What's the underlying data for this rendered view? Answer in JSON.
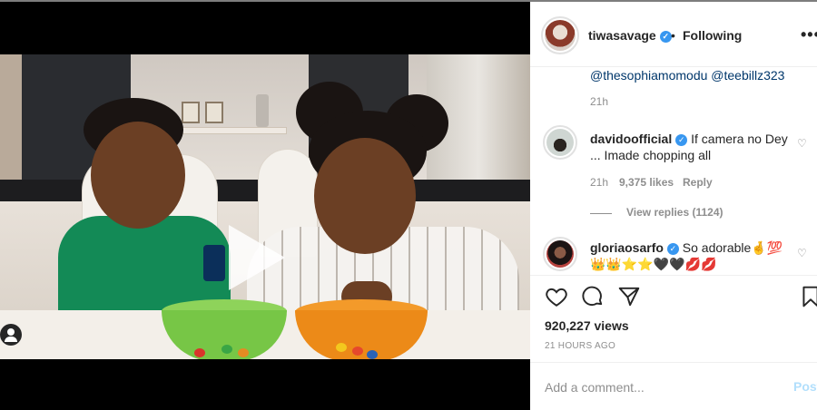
{
  "post": {
    "author": "tiwasavage",
    "follow_status": "Following",
    "more_label": "•••",
    "separator": "•"
  },
  "comments": {
    "mention_line": "@thesophiamomodu @teebillz323",
    "mention_time": "21h",
    "items": [
      {
        "username": "davidoofficial",
        "text": "If camera no Dey ... Imade chopping all",
        "time": "21h",
        "likes": "9,375 likes",
        "reply_label": "Reply",
        "view_replies": "View replies (1124)"
      },
      {
        "username": "gloriaosarfo",
        "text": "So adorable🤞💯 👑👑⭐⭐🖤🖤💋💋"
      }
    ]
  },
  "stats": {
    "views": "920,227 views",
    "posted": "21 HOURS AGO"
  },
  "composer": {
    "placeholder": "Add a comment...",
    "post_label": "Post"
  },
  "icons": {
    "verified": "verified-badge-icon",
    "like": "heart-icon",
    "comment": "comment-icon",
    "share": "share-icon",
    "save": "bookmark-icon",
    "play": "play-icon",
    "tag": "user-tag-icon"
  },
  "colors": {
    "verified_blue": "#3897f0",
    "link_blue": "#00376b",
    "muted": "#8e8e8e",
    "post_button": "#b2dffc"
  }
}
